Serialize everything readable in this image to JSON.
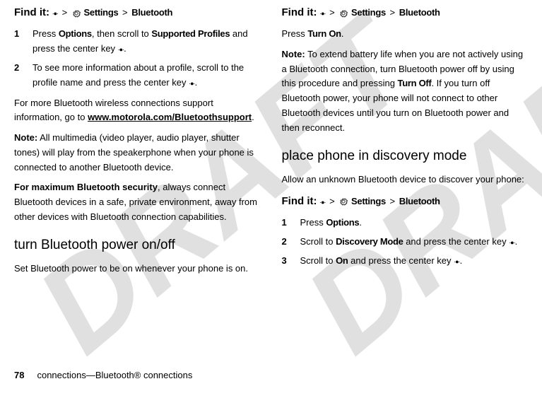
{
  "watermark": "DRAFT",
  "left": {
    "findit": {
      "label": "Find it:",
      "settings": "Settings",
      "bluetooth": "Bluetooth"
    },
    "step1": {
      "num": "1",
      "pre": "Press ",
      "options": "Options",
      "mid": ", then scroll to ",
      "profiles": "Supported Profiles",
      "post": " and press the center key ",
      "end": "."
    },
    "step2": {
      "num": "2",
      "pre": "To see more information about a profile, scroll to the profile name and press the center key ",
      "end": "."
    },
    "para1a": "For more Bluetooth wireless connections support information, go to ",
    "para1link": "www.motorola.com/Bluetoothsupport",
    "para1b": ".",
    "note_label": "Note:",
    "note_text": " All multimedia (video player, audio player, shutter tones) will play from the speakerphone when your phone is connected to another Bluetooth device.",
    "sec_label": "For maximum Bluetooth security",
    "sec_text": ", always connect Bluetooth devices in a safe, private environment, away from other devices with Bluetooth connection capabilities.",
    "h2": "turn Bluetooth power on/off",
    "para2": "Set Bluetooth power to be on whenever your phone is on."
  },
  "right": {
    "findit": {
      "label": "Find it:",
      "settings": "Settings",
      "bluetooth": "Bluetooth"
    },
    "press_pre": "Press ",
    "turn_on": "Turn On",
    "press_post": ".",
    "note_label": "Note:",
    "note_a": " To extend battery life when you are not actively using a Bluetooth connection, turn Bluetooth power off by using this procedure and pressing ",
    "turn_off": "Turn Off",
    "note_b": ". If you turn off Bluetooth power, your phone will not connect to other Bluetooth devices until you turn on Bluetooth power and then reconnect.",
    "h2": "place phone in discovery mode",
    "para": "Allow an unknown Bluetooth device to discover your phone:",
    "findit2": {
      "label": "Find it:",
      "settings": "Settings",
      "bluetooth": "Bluetooth"
    },
    "step1": {
      "num": "1",
      "pre": "Press ",
      "options": "Options",
      "post": "."
    },
    "step2": {
      "num": "2",
      "pre": "Scroll to ",
      "disc": "Discovery Mode",
      "mid": " and press the center key ",
      "end": "."
    },
    "step3": {
      "num": "3",
      "pre": "Scroll to ",
      "on": "On",
      "mid": " and press the center key ",
      "end": "."
    }
  },
  "footer": {
    "page": "78",
    "chapter": "connections—Bluetooth® connections"
  }
}
